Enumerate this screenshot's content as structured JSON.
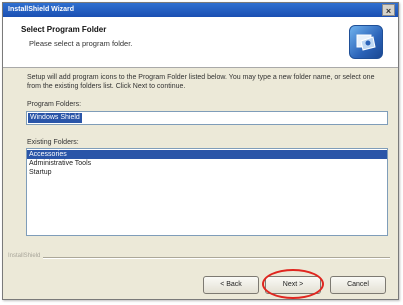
{
  "window": {
    "title": "InstallShield Wizard",
    "close_glyph": "×"
  },
  "header": {
    "title": "Select Program Folder",
    "subtitle": "Please select a program folder.",
    "logo_icon": "installshield-logo-icon"
  },
  "instructions": "Setup will add program icons to the Program Folder listed below. You may type a new folder name, or select one from the existing folders list. Click Next to continue.",
  "program_folder": {
    "label": "Program Folders:",
    "value": "Windows Shield"
  },
  "existing_folders": {
    "label": "Existing Folders:",
    "items": [
      "Accessories",
      "Administrative Tools",
      "Startup"
    ],
    "selected_index": 0
  },
  "footer": {
    "brand": "InstallShield"
  },
  "buttons": {
    "back": "< Back",
    "next": "Next >",
    "cancel": "Cancel"
  },
  "colors": {
    "highlight": "#e0261f",
    "selection": "#2a55a8",
    "titlebar": "#1a4fb2"
  }
}
